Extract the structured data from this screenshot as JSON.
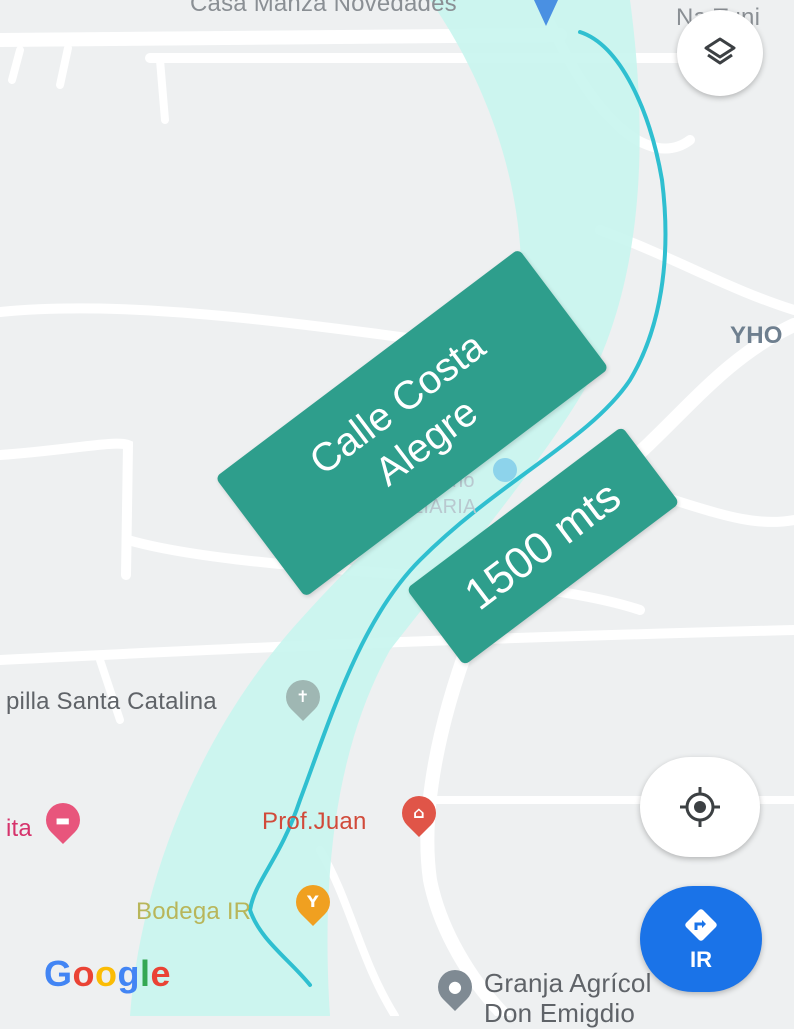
{
  "map": {
    "route_color": "#2fbfd0",
    "corridor_color": "#c9f5ef",
    "banner_color": "#2e9e8c"
  },
  "street_banner": {
    "line1": "Calle Costa",
    "line2": "Alegre"
  },
  "distance_banner": {
    "text": "1500 mts"
  },
  "labels": {
    "top_poi": "Casa Manza Novedades",
    "top_right": "Na Tuni",
    "right_edge": "YHO",
    "mid_faded_1": "ho",
    "mid_faded_2": "LIARIA",
    "capilla": "pilla Santa Catalina",
    "left_edge": "ita",
    "prof": "Prof.Juan",
    "bodega": "Bodega IR",
    "granja_line1": "Granja Agrícol",
    "granja_line2": "Don Emigdio"
  },
  "controls": {
    "layers_icon": "layers-icon",
    "locate_icon": "my-location-icon",
    "go_icon": "directions-icon",
    "go_label": "IR"
  },
  "branding": {
    "logo_letters": [
      "G",
      "o",
      "o",
      "g",
      "l",
      "e"
    ],
    "logo_colors": [
      "#4285f4",
      "#ea4335",
      "#fbbc05",
      "#4285f4",
      "#34a853",
      "#ea4335"
    ]
  }
}
